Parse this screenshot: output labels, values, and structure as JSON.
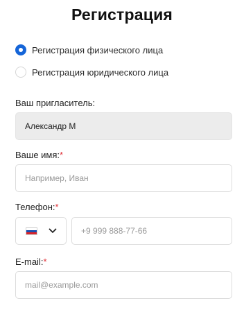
{
  "title": "Регистрация",
  "registration_type": {
    "options": [
      {
        "label": "Регистрация физического лица",
        "selected": true
      },
      {
        "label": "Регистрация юридического лица",
        "selected": false
      }
    ]
  },
  "inviter": {
    "label": "Ваш пригласитель:",
    "value": "Александр М"
  },
  "name": {
    "label": "Ваше имя:",
    "required_mark": "*",
    "placeholder": "Например, Иван"
  },
  "phone": {
    "label": "Телефон:",
    "required_mark": "*",
    "country_flag": "russia-flag-icon",
    "placeholder": "+9 999 888-77-66"
  },
  "email": {
    "label": "E-mail:",
    "required_mark": "*",
    "placeholder": "mail@example.com"
  },
  "colors": {
    "accent": "#1565d8",
    "required": "#e0333a",
    "readonly_bg": "#ececec"
  }
}
